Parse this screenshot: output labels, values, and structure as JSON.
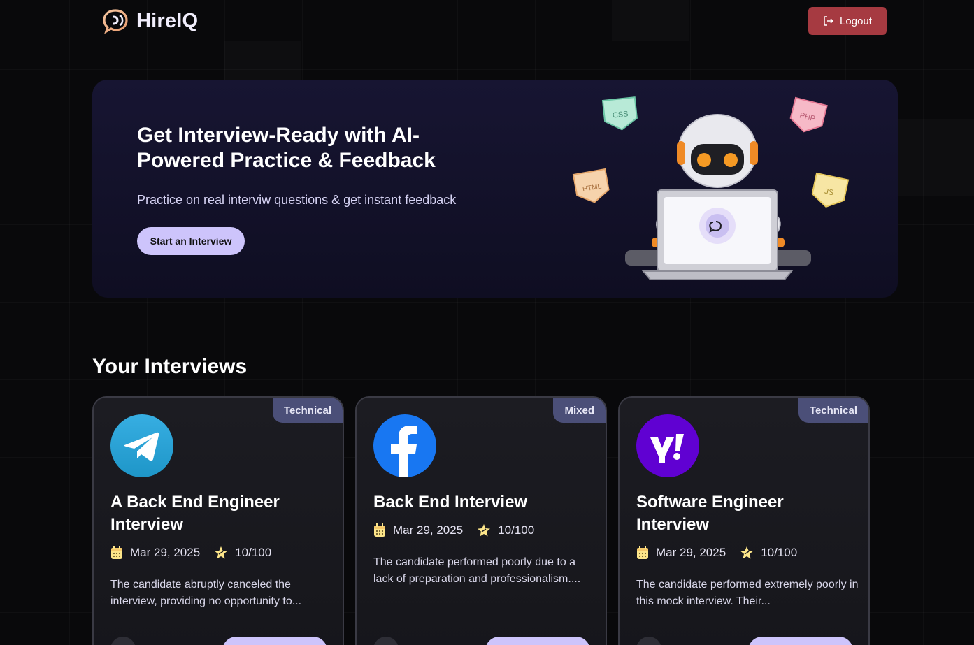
{
  "brand": {
    "name": "HireIQ"
  },
  "header": {
    "logout_label": "Logout"
  },
  "hero": {
    "title": "Get Interview-Ready with AI-Powered Practice & Feedback",
    "subtitle": "Practice on real interviw questions & get instant feedback",
    "cta_label": "Start an Interview",
    "tags": [
      "CSS",
      "PHP",
      "HTML",
      "JS"
    ]
  },
  "section": {
    "title": "Your Interviews"
  },
  "interviews": [
    {
      "type": "Technical",
      "logo": "telegram-logo",
      "title": "A Back End Engineer Interview",
      "date": "Mar 29, 2025",
      "score": "10/100",
      "summary": "The candidate abruptly canceled the interview, providing no opportunity to..."
    },
    {
      "type": "Mixed",
      "logo": "facebook-logo",
      "title": "Back End Interview",
      "date": "Mar 29, 2025",
      "score": "10/100",
      "summary": "The candidate performed poorly due to a lack of preparation and professionalism...."
    },
    {
      "type": "Technical",
      "logo": "yahoo-logo",
      "title": "Software Engineer Interview",
      "date": "Mar 29, 2025",
      "score": "10/100",
      "summary": "The candidate performed extremely poorly in this mock interview. Their..."
    }
  ],
  "colors": {
    "background": "#09090b",
    "logout": "#a63a41",
    "accent": "#cdc4fb",
    "badge": "#4b4f78",
    "star": "#fde68a"
  }
}
